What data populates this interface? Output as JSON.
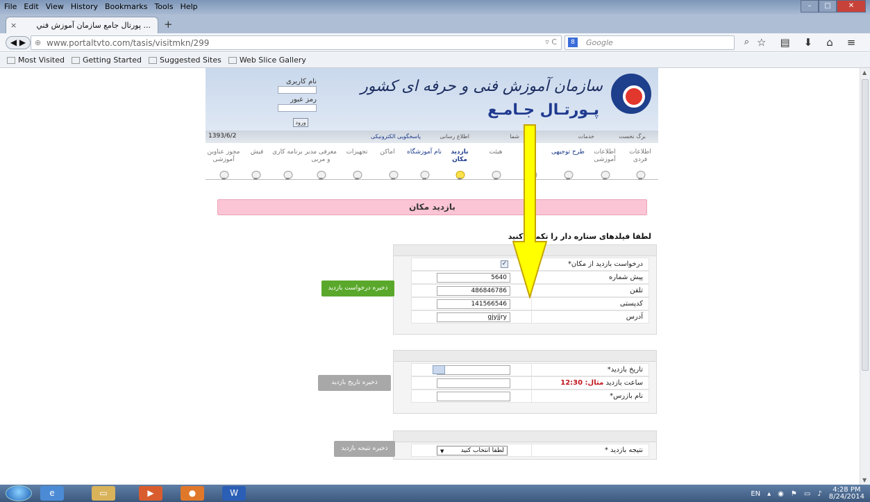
{
  "menubar": {
    "items": [
      "File",
      "Edit",
      "View",
      "History",
      "Bookmarks",
      "Tools",
      "Help"
    ]
  },
  "tab": {
    "title": "... پورتال جامع سازمان آموزش فني",
    "close": "×",
    "new": "+"
  },
  "nav": {
    "back_forward": "◀ ▶",
    "url": "www.portaltvto.com/tasis/visitmkn/299",
    "url_tools": "▿ C",
    "search_placeholder": "Google",
    "search_engine": "8"
  },
  "bookmarks": {
    "items": [
      "Most Visited",
      "Getting Started",
      "Suggested Sites",
      "Web Slice Gallery"
    ]
  },
  "header": {
    "org_name": "سازمان آموزش فنی و حرفه ای کشور",
    "portal_name": "پـورتـال جـامـع",
    "username_label": "نام کاربری",
    "password_label": "رمز عبور",
    "login_button": "ورود"
  },
  "navstrip": {
    "date": "1393/6/2",
    "items": [
      "برگ نخست",
      "خدمات",
      "شما",
      "اطلاع رسانی",
      "پاسخگویی الکترونیکی"
    ]
  },
  "steps": [
    "اطلاعات فردی",
    "اطلاعات آموزشی",
    "طرح توجیهی",
    "",
    "",
    "هیئت",
    "بازدید مکان",
    "نام آموزشگاه",
    "اماکن",
    "تجهیزات",
    "معرفی مدیر و مربی",
    "برنامه کاری",
    "فیش",
    "مجوز عناوین آموزشی"
  ],
  "page": {
    "title": "بازدید مکان",
    "notice": "لطفا فیلدهای ستاره دار را تکمیل کنید"
  },
  "form1": {
    "rows": [
      {
        "label": "درخواست بازدید از مکان*",
        "value": "✓"
      },
      {
        "label": "پیش شماره",
        "value": "5640"
      },
      {
        "label": "تلفن",
        "value": "486846786"
      },
      {
        "label": "کدپستی",
        "value": "141566546"
      },
      {
        "label": "آدرس",
        "value": "gjyjjry"
      }
    ],
    "button": "ذخیره درخواست بازدید"
  },
  "form2": {
    "rows": [
      {
        "label": "تاریخ بازدید*",
        "value": ""
      },
      {
        "label": "ساعت بازدید",
        "hint": "مثال: 12:30",
        "value": ""
      },
      {
        "label": "نام بازرس*",
        "value": ""
      }
    ],
    "button": "ذخیره تاریخ بازدید"
  },
  "form3": {
    "rows": [
      {
        "label": "نتیجه بازدید *",
        "value": "لطفا انتخاب کنید"
      }
    ],
    "button": "ذخیره نتیجه بازدید"
  },
  "taskbar": {
    "lang": "EN",
    "time": "4:28 PM",
    "date": "8/24/2014"
  },
  "colors": {
    "accent_pink": "#fbc5d6",
    "arrow_yellow": "#ffff00",
    "save_green": "#5aa82b",
    "save_gray": "#a8a8a8"
  }
}
